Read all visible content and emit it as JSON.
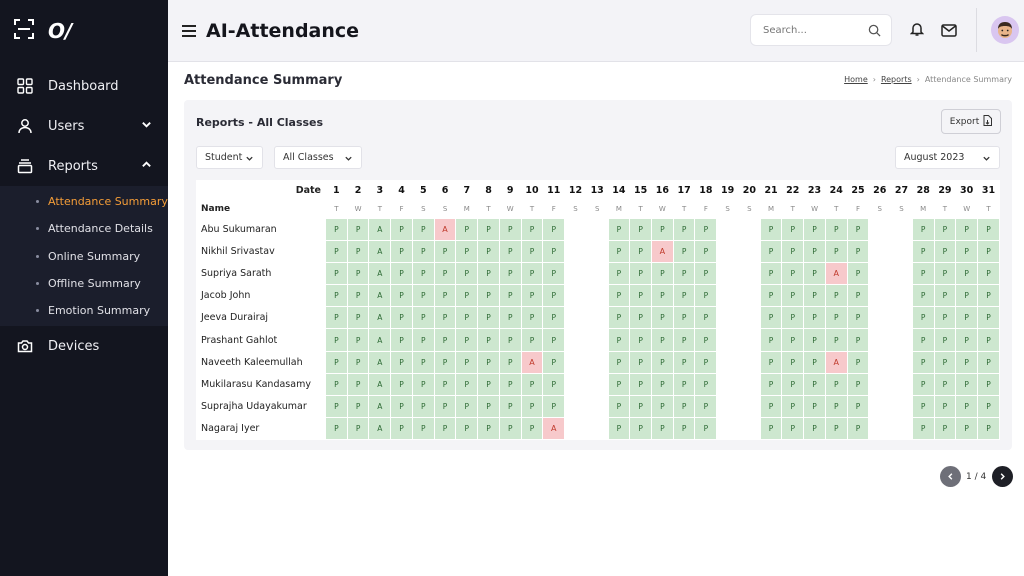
{
  "app": {
    "title": "AI-Attendance",
    "logo_text": "O/"
  },
  "sidebar": {
    "items": [
      {
        "label": "Dashboard",
        "icon": "grid-icon"
      },
      {
        "label": "Users",
        "icon": "user-icon"
      },
      {
        "label": "Reports",
        "icon": "reports-icon"
      },
      {
        "label": "Devices",
        "icon": "camera-icon"
      }
    ],
    "report_subitems": [
      {
        "label": "Attendance Summary",
        "active": true
      },
      {
        "label": "Attendance Details",
        "active": false
      },
      {
        "label": "Online Summary",
        "active": false
      },
      {
        "label": "Offline Summary",
        "active": false
      },
      {
        "label": "Emotion Summary",
        "active": false
      }
    ]
  },
  "topbar": {
    "search_placeholder": "Search..."
  },
  "page": {
    "title": "Attendance Summary",
    "breadcrumb": [
      "Home",
      "Reports",
      "Attendance Summary"
    ]
  },
  "card": {
    "title": "Reports - All Classes",
    "export_label": "Export",
    "filter_type": "Student",
    "filter_class": "All Classes",
    "filter_month": "August 2023"
  },
  "table": {
    "date_label": "Date",
    "name_label": "Name",
    "days": [
      1,
      2,
      3,
      4,
      5,
      6,
      7,
      8,
      9,
      10,
      11,
      12,
      13,
      14,
      15,
      16,
      17,
      18,
      19,
      20,
      21,
      22,
      23,
      24,
      25,
      26,
      27,
      28,
      29,
      30,
      31
    ],
    "weekdays": [
      "T",
      "W",
      "T",
      "F",
      "S",
      "S",
      "M",
      "T",
      "W",
      "T",
      "F",
      "S",
      "S",
      "M",
      "T",
      "W",
      "T",
      "F",
      "S",
      "S",
      "M",
      "T",
      "W",
      "T",
      "F",
      "S",
      "S",
      "M",
      "T",
      "W",
      "T"
    ],
    "rows": [
      {
        "name": "Abu Sukumaran",
        "absent": [
          6
        ]
      },
      {
        "name": "Nikhil Srivastav",
        "absent": [
          16
        ]
      },
      {
        "name": "Supriya Sarath",
        "absent": [
          24
        ]
      },
      {
        "name": "Jacob John",
        "absent": []
      },
      {
        "name": "Jeeva Durairaj",
        "absent": []
      },
      {
        "name": "Prashant Gahlot",
        "absent": []
      },
      {
        "name": "Naveeth Kaleemullah",
        "absent": [
          10,
          24
        ]
      },
      {
        "name": "Mukilarasu Kandasamy",
        "absent": []
      },
      {
        "name": "Suprajha Udayakumar",
        "absent": []
      },
      {
        "name": "Nagaraj Iyer",
        "absent": [
          11
        ]
      }
    ],
    "empty_days": [
      12,
      13,
      19,
      20,
      26,
      27
    ],
    "column3_mark": "A",
    "present_mark": "P",
    "absent_mark": "A"
  },
  "pagination": {
    "current": 1,
    "total": 4,
    "label": "1 / 4"
  },
  "colors": {
    "present": "#cde7cf",
    "absent": "#f7c9cb",
    "sidebar": "#13151f",
    "accent": "#f39c38"
  }
}
